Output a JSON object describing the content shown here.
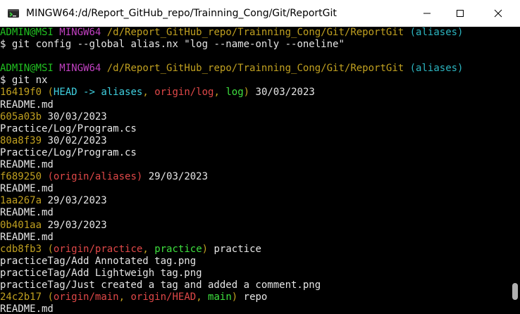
{
  "window": {
    "title": "MINGW64:/d/Report_GitHub_repo/Trainning_Cong/Git/ReportGit",
    "icons": {
      "app": "mingw-terminal-icon",
      "minimize": "minimize-icon",
      "maximize": "maximize-icon",
      "close": "close-icon"
    }
  },
  "prompt": {
    "user_host": "ADMIN@MSI",
    "system": "MINGW64",
    "path": "/d/Report_GitHub_repo/Trainning_Cong/Git/ReportGit",
    "branch": "(aliases)",
    "symbol": "$"
  },
  "commands": [
    "git config --global alias.nx \"log --name-only --oneline\"",
    "git nx"
  ],
  "log": {
    "c1": {
      "hash": "16419f0",
      "open": "(",
      "head": "HEAD -> aliases",
      "ref2": "origin/log",
      "ref3": "log",
      "close": ")",
      "sep": ", ",
      "message": "30/03/2023",
      "file1": "README.md"
    },
    "c2": {
      "hash": "605a03b",
      "message": "30/03/2023",
      "file1": "Practice/Log/Program.cs"
    },
    "c3": {
      "hash": "80a8f39",
      "message": "30/02/2023",
      "file1": "Practice/Log/Program.cs",
      "file2": "README.md"
    },
    "c4": {
      "hash": "f689250",
      "refs": "(origin/aliases)",
      "message": "29/03/2023",
      "file1": "README.md"
    },
    "c5": {
      "hash": "1aa267a",
      "message": "29/03/2023",
      "file1": "README.md"
    },
    "c6": {
      "hash": "0b401aa",
      "message": "29/03/2023",
      "file1": "README.md"
    },
    "c7": {
      "hash": "cdb8fb3",
      "open": "(",
      "ref1": "origin/practice",
      "ref2": "practice",
      "close": ")",
      "sep": ", ",
      "message": "practice",
      "file1": "practiceTag/Add Annotated tag.png",
      "file2": "practiceTag/Add Lightweigh tag.png",
      "file3": "practiceTag/Just created a tag and added a comment.png"
    },
    "c8": {
      "hash": "24c2b17",
      "open": "(",
      "ref1": "origin/main",
      "ref2": "origin/HEAD",
      "ref3": "main",
      "close": ")",
      "sep": ", ",
      "message": "repo",
      "file1": "README.md"
    }
  },
  "colors": {
    "user_host": "#20c020",
    "system": "#c040c0",
    "path": "#c0a020",
    "branch": "#2cb5c0",
    "head": "#3fd0e0",
    "remote_ref": "#e04848",
    "local_ref": "#3ee03e",
    "text": "#e6e6e6",
    "background": "#000000",
    "titlebar": "#ffffff"
  }
}
